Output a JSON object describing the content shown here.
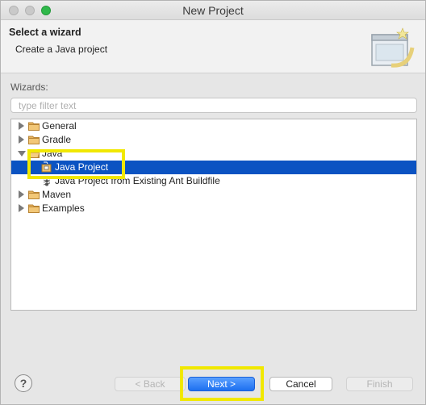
{
  "window": {
    "title": "New Project"
  },
  "header": {
    "title": "Select a wizard",
    "description": "Create a Java project"
  },
  "wizards": {
    "label": "Wizards:",
    "filter_placeholder": "type filter text",
    "tree": [
      {
        "label": "General",
        "expanded": false
      },
      {
        "label": "Gradle",
        "expanded": false
      },
      {
        "label": "Java",
        "expanded": true
      },
      {
        "label": "Java Project",
        "selected": true
      },
      {
        "label": "Java Project from Existing Ant Buildfile"
      },
      {
        "label": "Maven",
        "expanded": false
      },
      {
        "label": "Examples",
        "expanded": false
      }
    ]
  },
  "buttons": {
    "help": "?",
    "back": "< Back",
    "next": "Next >",
    "cancel": "Cancel",
    "finish": "Finish"
  },
  "colors": {
    "selection": "#0b53c2",
    "highlight": "#f1e800",
    "default_button": "#1d6ff0"
  }
}
